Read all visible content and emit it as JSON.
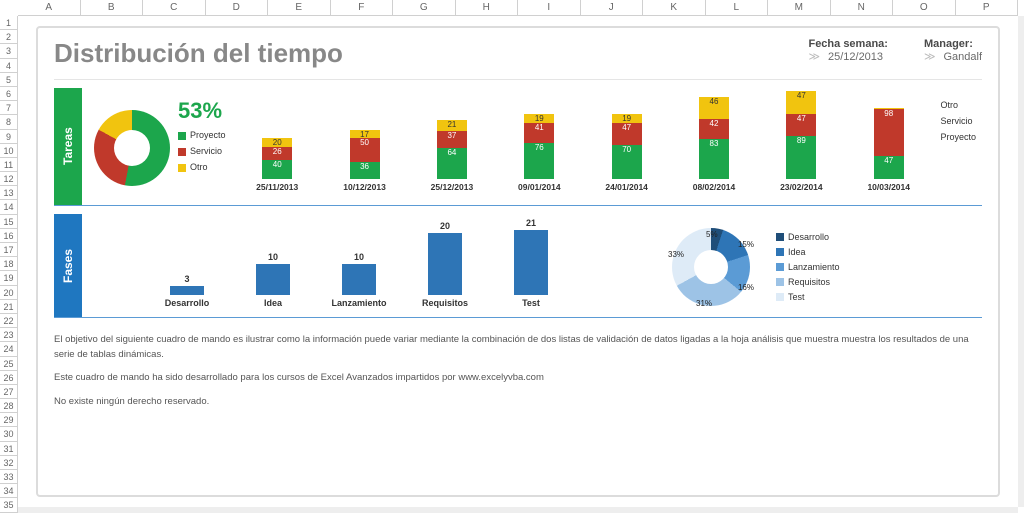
{
  "cols": [
    "A",
    "B",
    "C",
    "D",
    "E",
    "F",
    "G",
    "H",
    "I",
    "J",
    "K",
    "L",
    "M",
    "N",
    "O",
    "P"
  ],
  "title": "Distribución del tiempo",
  "meta": {
    "date_label": "Fecha semana:",
    "date_value": "25/12/2013",
    "mgr_label": "Manager:",
    "mgr_value": "Gandalf"
  },
  "tareas": {
    "heading": "Tareas",
    "pct": "53%",
    "leg_proyecto": "Proyecto",
    "leg_servicio": "Servicio",
    "leg_otro": "Otro"
  },
  "fases": {
    "heading": "Fases",
    "leg_desarrollo": "Desarrollo",
    "leg_idea": "Idea",
    "leg_lanzamiento": "Lanzamiento",
    "leg_requisitos": "Requisitos",
    "leg_test": "Test"
  },
  "notes": {
    "p1": "El objetivo del siguiente cuadro de mando es ilustrar como la información puede variar mediante la combinación de dos listas de validación de datos ligadas a la hoja análisis que muestra muestra los resultados de una serie de tablas dinámicas.",
    "p2": "Este cuadro de mando ha sido desarrollado para los cursos de Excel Avanzados impartidos por www.excelyvba.com",
    "p3": "No existe ningún derecho reservado."
  },
  "chart_data": [
    {
      "type": "pie",
      "name": "tareas_donut",
      "categories": [
        "Proyecto",
        "Servicio",
        "Otro"
      ],
      "values": [
        53,
        30,
        17
      ],
      "title": "",
      "unit": "%"
    },
    {
      "type": "bar",
      "name": "tareas_stacked",
      "stacked": true,
      "categories": [
        "25/11/2013",
        "10/12/2013",
        "25/12/2013",
        "09/01/2014",
        "24/01/2014",
        "08/02/2014",
        "23/02/2014",
        "10/03/2014"
      ],
      "series": [
        {
          "name": "Proyecto",
          "color": "#1ca64c",
          "values": [
            40,
            36,
            64,
            76,
            70,
            83,
            89,
            47
          ]
        },
        {
          "name": "Servicio",
          "color": "#c0392b",
          "values": [
            26,
            50,
            37,
            41,
            47,
            42,
            47,
            98
          ]
        },
        {
          "name": "Otro",
          "color": "#f1c40f",
          "values": [
            20,
            17,
            21,
            19,
            19,
            46,
            47,
            3
          ]
        }
      ],
      "ylim": [
        0,
        200
      ]
    },
    {
      "type": "bar",
      "name": "fases_bar",
      "categories": [
        "Desarrollo",
        "Idea",
        "Lanzamiento",
        "Requisitos",
        "Test"
      ],
      "values": [
        3,
        10,
        10,
        20,
        21
      ],
      "color": "#2e75b6",
      "ylim": [
        0,
        25
      ]
    },
    {
      "type": "pie",
      "name": "fases_donut",
      "categories": [
        "Desarrollo",
        "Idea",
        "Lanzamiento",
        "Requisitos",
        "Test"
      ],
      "values": [
        5,
        15,
        16,
        31,
        33
      ],
      "unit": "%"
    }
  ]
}
